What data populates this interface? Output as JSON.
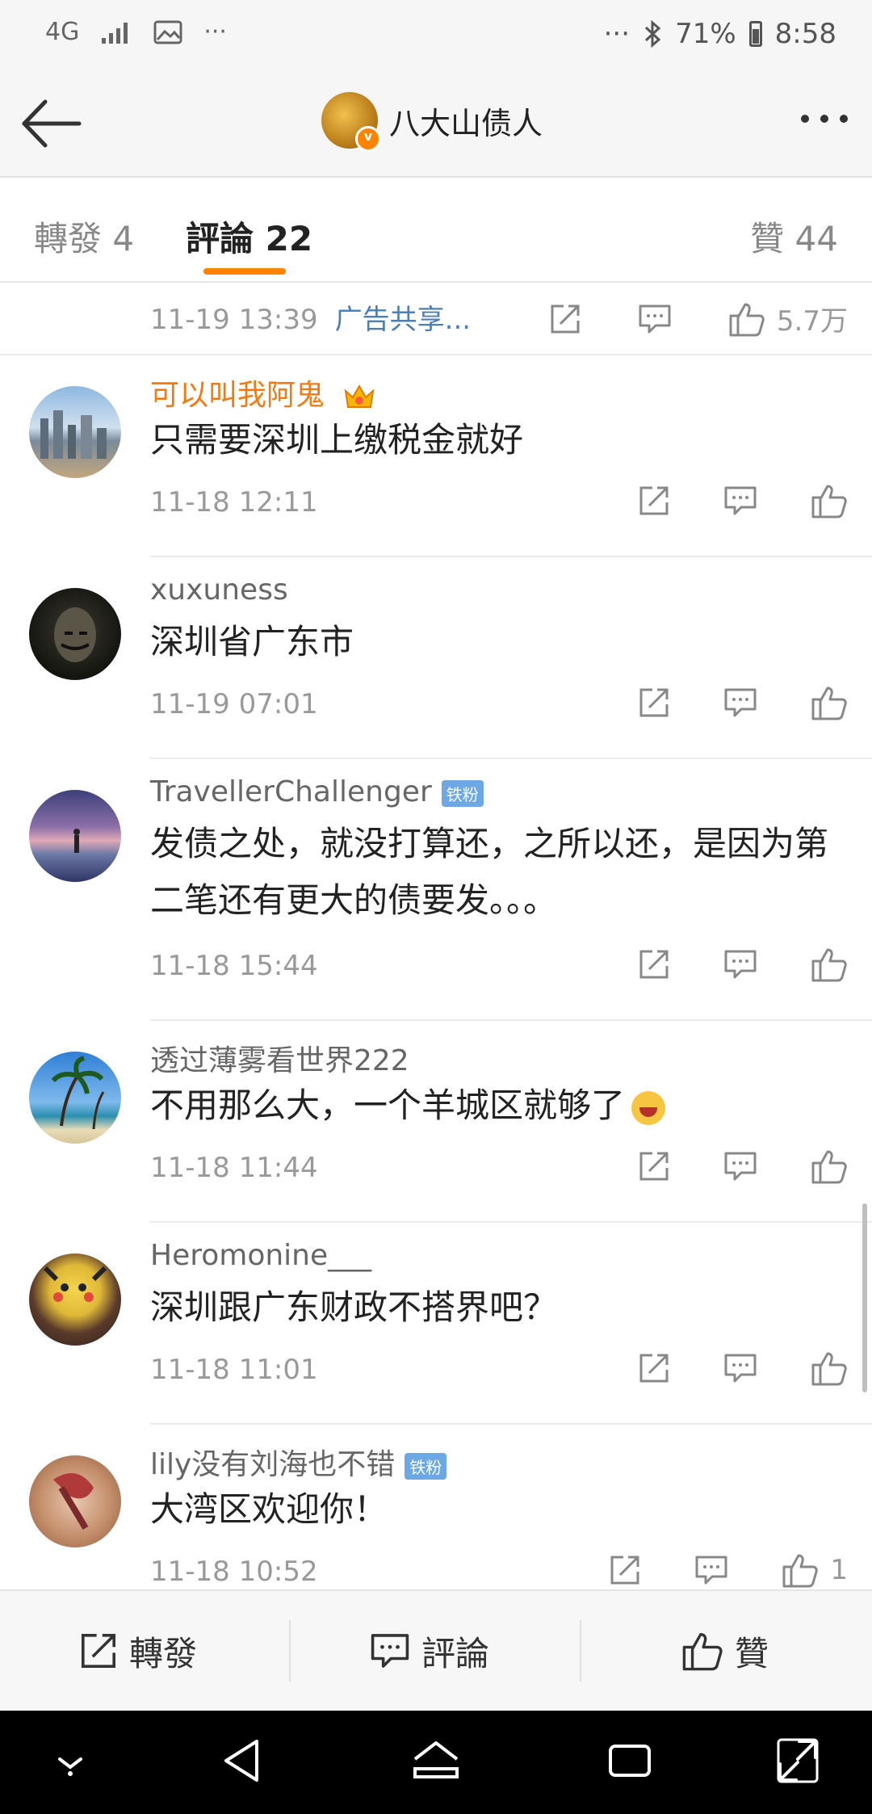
{
  "status_bar": {
    "network": "4G",
    "dots_left": "···",
    "dots_right": "···",
    "battery": "71%",
    "time": "8:58"
  },
  "header": {
    "title": "八大山债人",
    "verified_badge": "v",
    "back_icon": "back-arrow-icon",
    "more_icon": "more-dots-icon"
  },
  "tabs": [
    {
      "label": "轉發 4"
    },
    {
      "label": "評論 22"
    },
    {
      "label": "贊 44"
    }
  ],
  "prev_comment": {
    "time": "11-19 13:39",
    "ad": "广告共享...",
    "likes": "5.7万"
  },
  "comments": [
    {
      "user": "可以叫我阿鬼",
      "text": "只需要深圳上缴税金就好",
      "time": "11-18 12:11"
    },
    {
      "user": "xuxuness",
      "text": "深圳省广东市",
      "time": "11-19 07:01"
    },
    {
      "user": "TravellerChallenger",
      "badge": "铁粉",
      "text": "发债之处，就没打算还，之所以还，是因为第二笔还有更大的债要发。。。",
      "time": "11-18 15:44"
    },
    {
      "user": "透过薄雾看世界222",
      "text": "不用那么大，一个羊城区就够了",
      "time": "11-18 11:44"
    },
    {
      "user": "Heromonine___",
      "text": "深圳跟广东财政不搭界吧？",
      "time": "11-18 11:01"
    },
    {
      "user": "lily没有刘海也不错",
      "badge": "铁粉",
      "text": "大湾区欢迎你！",
      "time": "11-18 10:52",
      "likes": "1"
    }
  ],
  "bottom_bar": {
    "repost": "轉發",
    "comment": "評論",
    "like": "贊"
  },
  "colors": {
    "accent": "#ff8200",
    "link": "#4c7fb5",
    "fan_badge": "#6da8e6"
  }
}
